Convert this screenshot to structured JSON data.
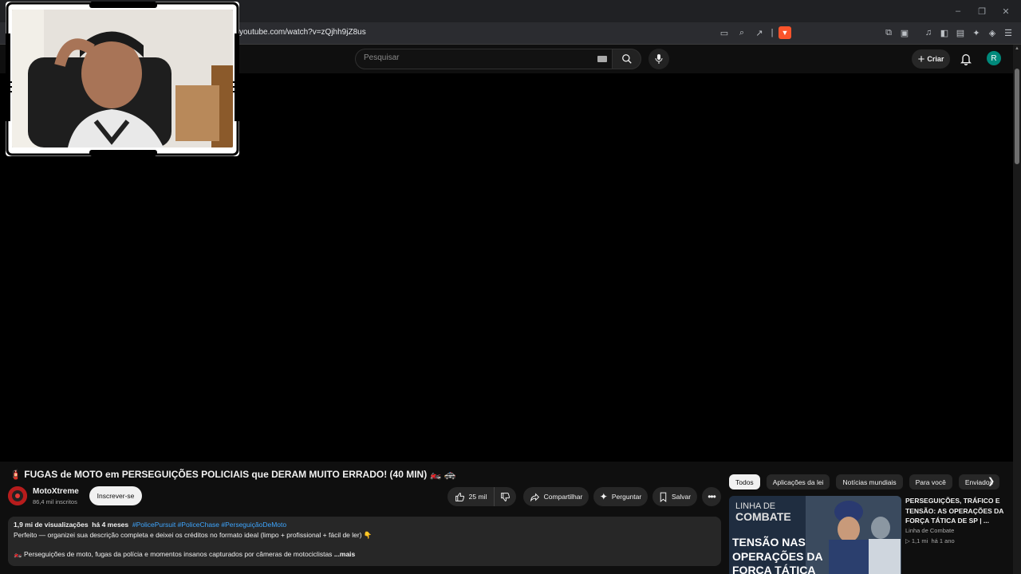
{
  "browser": {
    "url": "youtube.com/watch?v=zQjhh9jZ8us",
    "window_controls": {
      "minimize": "–",
      "restore": "❐",
      "close": "✕"
    }
  },
  "masthead": {
    "search_placeholder": "Pesquisar",
    "create_label": "Criar",
    "avatar_letter": "R"
  },
  "video": {
    "title": "🧯 FUGAS de MOTO em PERSEGUIÇÕES POLICIAIS que DERAM MUITO ERRADO! (40 MIN) 🏍️ 🚓",
    "channel_name": "MotoXtreme",
    "subscribers": "86,4 mil inscritos",
    "subscribe_label": "Inscrever-se",
    "likes": "25 mil",
    "share_label": "Compartilhar",
    "ask_label": "Perguntar",
    "save_label": "Salvar"
  },
  "description": {
    "views": "1,9 mi de visualizações",
    "age": "há 4 meses",
    "tags": "#PolicePursuit #PoliceChase #PerseguiçãoDeMoto",
    "line1": "Perfeito — organizei sua descrição completa e deixei os créditos no formato ideal (limpo + profissional + fácil de ler) 👇",
    "line2": "🏍️ Perseguições de moto, fugas da polícia e momentos insanos capturados por câmeras de motociclistas",
    "more_label": "...mais"
  },
  "chips": [
    "Todos",
    "Aplicações da lei",
    "Notícias mundiais",
    "Para você",
    "Enviados"
  ],
  "recommendation": {
    "title": "PERSEGUIÇÕES, TRÁFICO E TENSÃO: AS OPERAÇÕES DA FORÇA TÁTICA DE SP | ...",
    "channel": "Linha de Combate",
    "views": "1,1 mi",
    "age": "há 1 ano",
    "thumb_logo_top": "LINHA DE",
    "thumb_logo_bottom": "COMBATE",
    "thumb_text_1": "TENSÃO NAS",
    "thumb_text_2": "OPERAÇÕES DA",
    "thumb_text_3": "FORÇA TÁTICA"
  },
  "colors": {
    "accent_link": "#3ea6ff",
    "avatar": "#00897b",
    "brave": "#fb542b"
  }
}
